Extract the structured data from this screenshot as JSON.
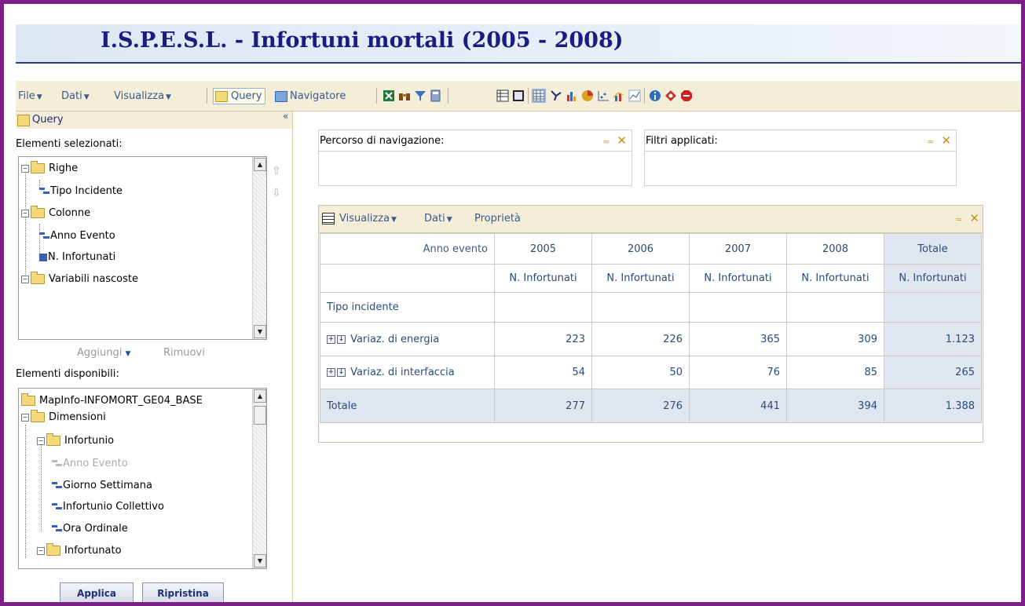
{
  "app_title": "I.S.P.E.S.L. - Infortuni mortali (2005 - 2008)",
  "menubar": {
    "file": "File",
    "dati": "Dati",
    "visualizza": "Visualizza",
    "query": "Query",
    "navigatore": "Navigatore"
  },
  "left": {
    "header": "Query",
    "selected_label": "Elementi selezionati:",
    "selected_tree": {
      "righe": "Righe",
      "tipo_incidente": "Tipo Incidente",
      "colonne": "Colonne",
      "anno_evento": "Anno Evento",
      "n_infortunati": "N. Infortunati",
      "variabili_nascoste": "Variabili nascoste"
    },
    "aggiungi": "Aggiungi",
    "rimuovi": "Rimuovi",
    "available_label": "Elementi disponibili:",
    "available_tree": {
      "root": "MapInfo-INFOMORT_GE04_BASE",
      "dimensioni": "Dimensioni",
      "infortunio": "Infortunio",
      "anno_evento": "Anno Evento",
      "giorno_settimana": "Giorno Settimana",
      "infortunio_collettivo": "Infortunio Collettivo",
      "ora_ordinale": "Ora Ordinale",
      "infortunato": "Infortunato"
    },
    "applica": "Applica",
    "ripristina": "Ripristina"
  },
  "panels": {
    "percorso": "Percorso di navigazione:",
    "filtri": "Filtri applicati:"
  },
  "grid": {
    "toolbar": {
      "visualizza": "Visualizza",
      "dati": "Dati",
      "proprieta": "Proprietà"
    },
    "anno_label": "Anno evento",
    "years": [
      "2005",
      "2006",
      "2007",
      "2008"
    ],
    "totale_col": "Totale",
    "measure": "N. Infortunati",
    "row_header": "Tipo incidente",
    "rows": [
      {
        "label": "Variaz. di energia",
        "values": [
          "223",
          "226",
          "365",
          "309"
        ],
        "total": "1.123"
      },
      {
        "label": "Variaz. di interfaccia",
        "values": [
          "54",
          "50",
          "76",
          "85"
        ],
        "total": "265"
      }
    ],
    "totale_row": {
      "label": "Totale",
      "values": [
        "277",
        "276",
        "441",
        "394"
      ],
      "total": "1.388"
    }
  }
}
